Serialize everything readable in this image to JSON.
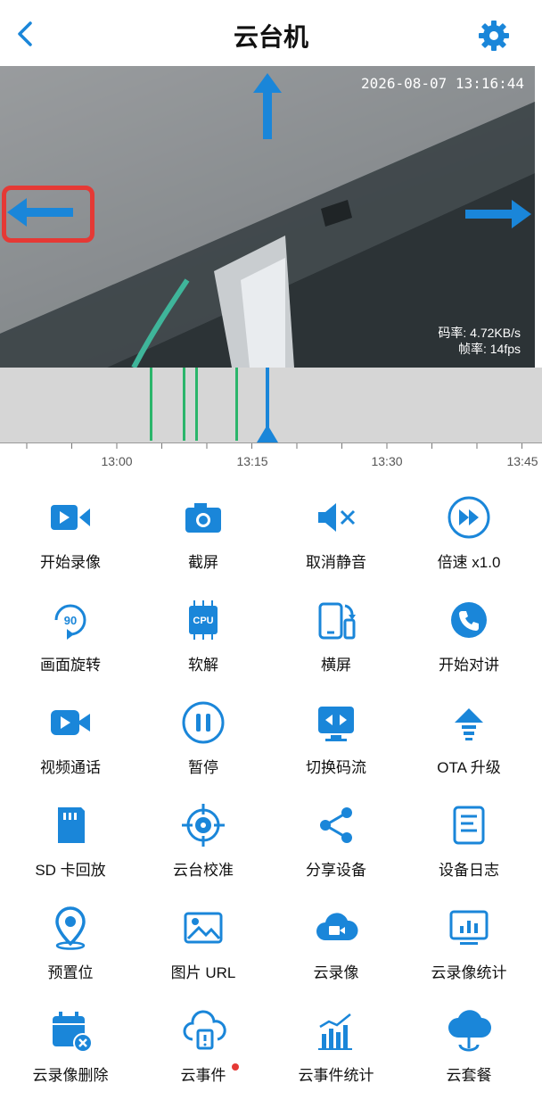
{
  "header": {
    "title": "云台机"
  },
  "video": {
    "timestamp": "2026-08-07  13:16:44",
    "bitrate": "码率: 4.72KB/s",
    "framerate": "帧率: 14fps"
  },
  "timeline": {
    "labels": [
      "13:00",
      "13:15",
      "13:30",
      "13:45"
    ]
  },
  "accent": "#1a86d9",
  "controls": [
    {
      "label": "开始录像",
      "icon": "video-camera-icon"
    },
    {
      "label": "截屏",
      "icon": "camera-icon"
    },
    {
      "label": "取消静音",
      "icon": "mute-icon"
    },
    {
      "label": "倍速 x1.0",
      "icon": "fast-forward-icon"
    },
    {
      "label": "画面旋转",
      "icon": "rotate-90-icon"
    },
    {
      "label": "软解",
      "icon": "cpu-icon"
    },
    {
      "label": "横屏",
      "icon": "landscape-icon"
    },
    {
      "label": "开始对讲",
      "icon": "phone-icon"
    },
    {
      "label": "视频通话",
      "icon": "video-call-icon"
    },
    {
      "label": "暂停",
      "icon": "pause-icon"
    },
    {
      "label": "切换码流",
      "icon": "switch-stream-icon"
    },
    {
      "label": "OTA 升级",
      "icon": "upgrade-icon"
    },
    {
      "label": "SD 卡回放",
      "icon": "sd-card-icon"
    },
    {
      "label": "云台校准",
      "icon": "crosshair-icon"
    },
    {
      "label": "分享设备",
      "icon": "share-icon"
    },
    {
      "label": "设备日志",
      "icon": "log-icon"
    },
    {
      "label": "预置位",
      "icon": "location-pin-icon"
    },
    {
      "label": "图片 URL",
      "icon": "image-icon"
    },
    {
      "label": "云录像",
      "icon": "cloud-video-icon"
    },
    {
      "label": "云录像统计",
      "icon": "chart-monitor-icon"
    },
    {
      "label": "云录像删除",
      "icon": "calendar-delete-icon"
    },
    {
      "label": "云事件",
      "icon": "cloud-event-icon"
    },
    {
      "label": "云事件统计",
      "icon": "bar-chart-icon"
    },
    {
      "label": "云套餐",
      "icon": "cloud-plan-icon"
    }
  ]
}
